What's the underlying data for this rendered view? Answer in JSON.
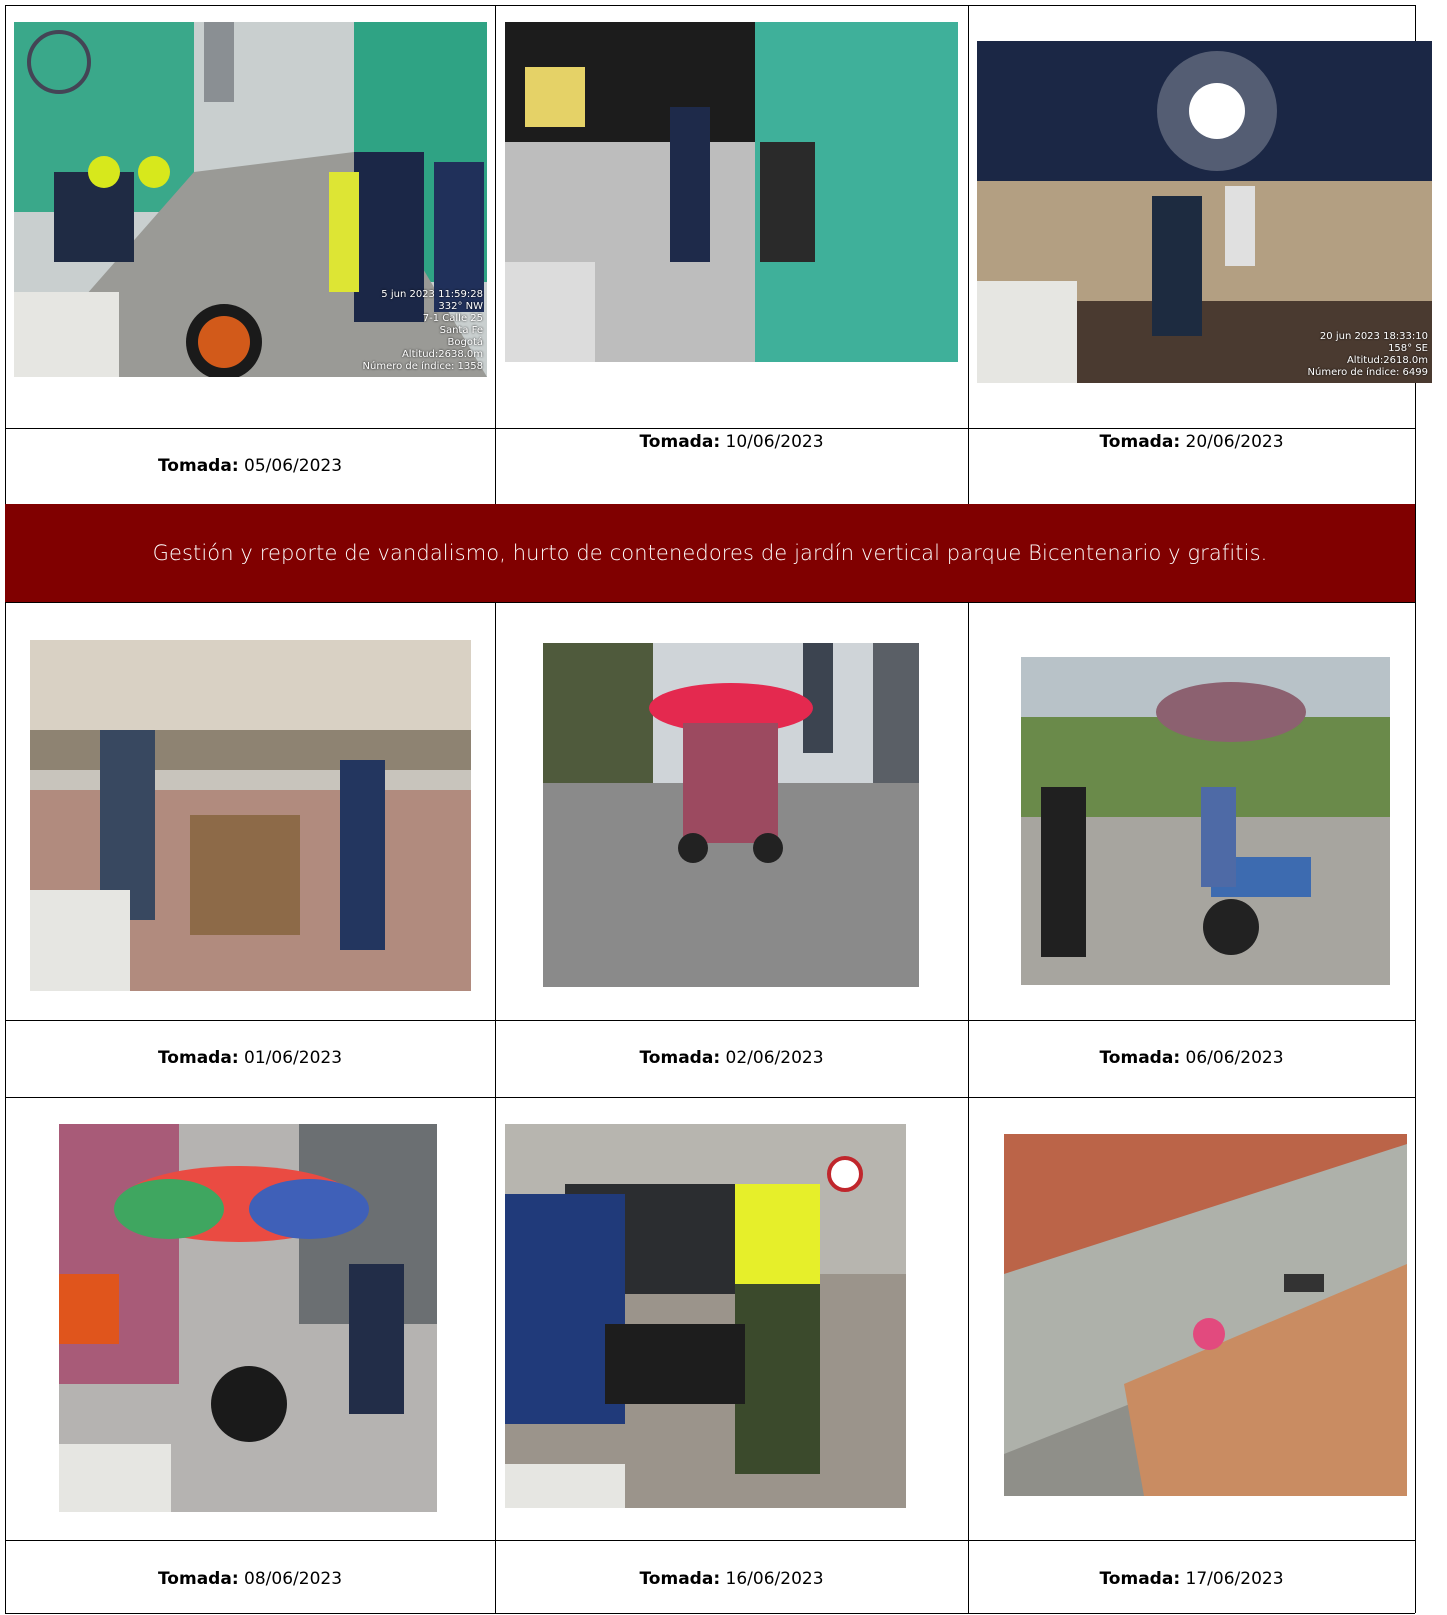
{
  "banner": {
    "text": "Gestión y reporte de vandalismo, hurto de contenedores de jardín vertical parque Bicentenario y grafitis.",
    "background": "#800000"
  },
  "caption_label": "Tomada:",
  "row1": [
    {
      "date": "05/06/2023",
      "stamp": "5 jun 2023 11:59:28\n332° NW\n7-1 Calle 25\nSanta Fe\nBogotá\nAltitud:2638.0m\nNúmero de índice: 1358"
    },
    {
      "date": "10/06/2023",
      "stamp": ""
    },
    {
      "date": "20/06/2023",
      "stamp": "20 jun 2023 18:33:10\n158° SE\nAltitud:2618.0m\nNúmero de índice: 6499"
    }
  ],
  "row2": [
    {
      "date": "01/06/2023"
    },
    {
      "date": "02/06/2023"
    },
    {
      "date": "06/06/2023"
    }
  ],
  "row3": [
    {
      "date": "08/06/2023"
    },
    {
      "date": "16/06/2023"
    },
    {
      "date": "17/06/2023"
    }
  ]
}
